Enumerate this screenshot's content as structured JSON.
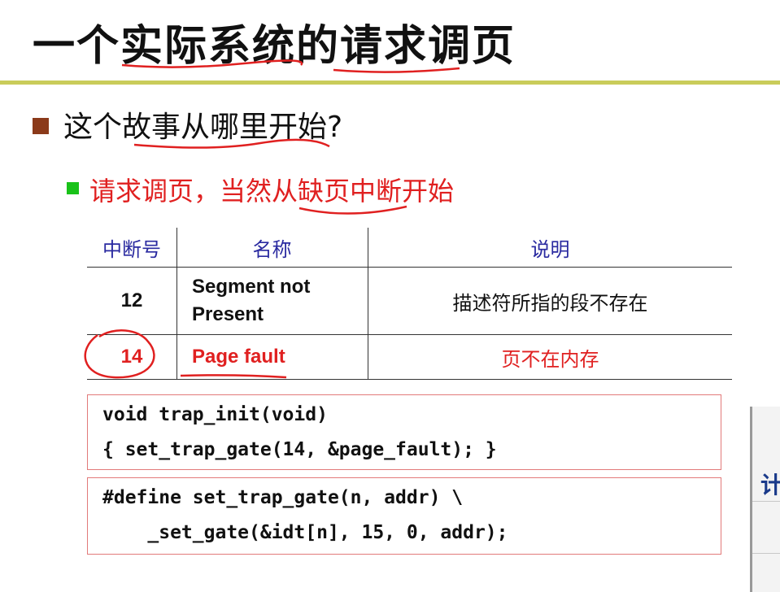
{
  "slide": {
    "title": "一个实际系统的请求调页",
    "bullet1": "这个故事从哪里开始?",
    "bullet2": "请求调页，当然从缺页中断开始"
  },
  "table": {
    "headers": [
      "中断号",
      "名称",
      "说明"
    ],
    "rows": [
      {
        "num": "12",
        "name_line1": "Segment not",
        "name_line2": "Present",
        "desc": "描述符所指的段不存在"
      },
      {
        "num": "14",
        "name": "Page fault",
        "desc": "页不在内存"
      }
    ]
  },
  "code": {
    "block1": [
      "void trap_init(void)",
      "{ set_trap_gate(14, &page_fault); }"
    ],
    "block2": [
      "#define set_trap_gate(n, addr) \\",
      "    _set_gate(&idt[n], 15, 0, addr);"
    ]
  },
  "side": {
    "fragment": "计"
  },
  "colors": {
    "accent_rule": "#c9cc5a",
    "highlight_red": "#e02020",
    "bullet_green": "#19c219",
    "bullet_brown": "#8b3a1a"
  }
}
